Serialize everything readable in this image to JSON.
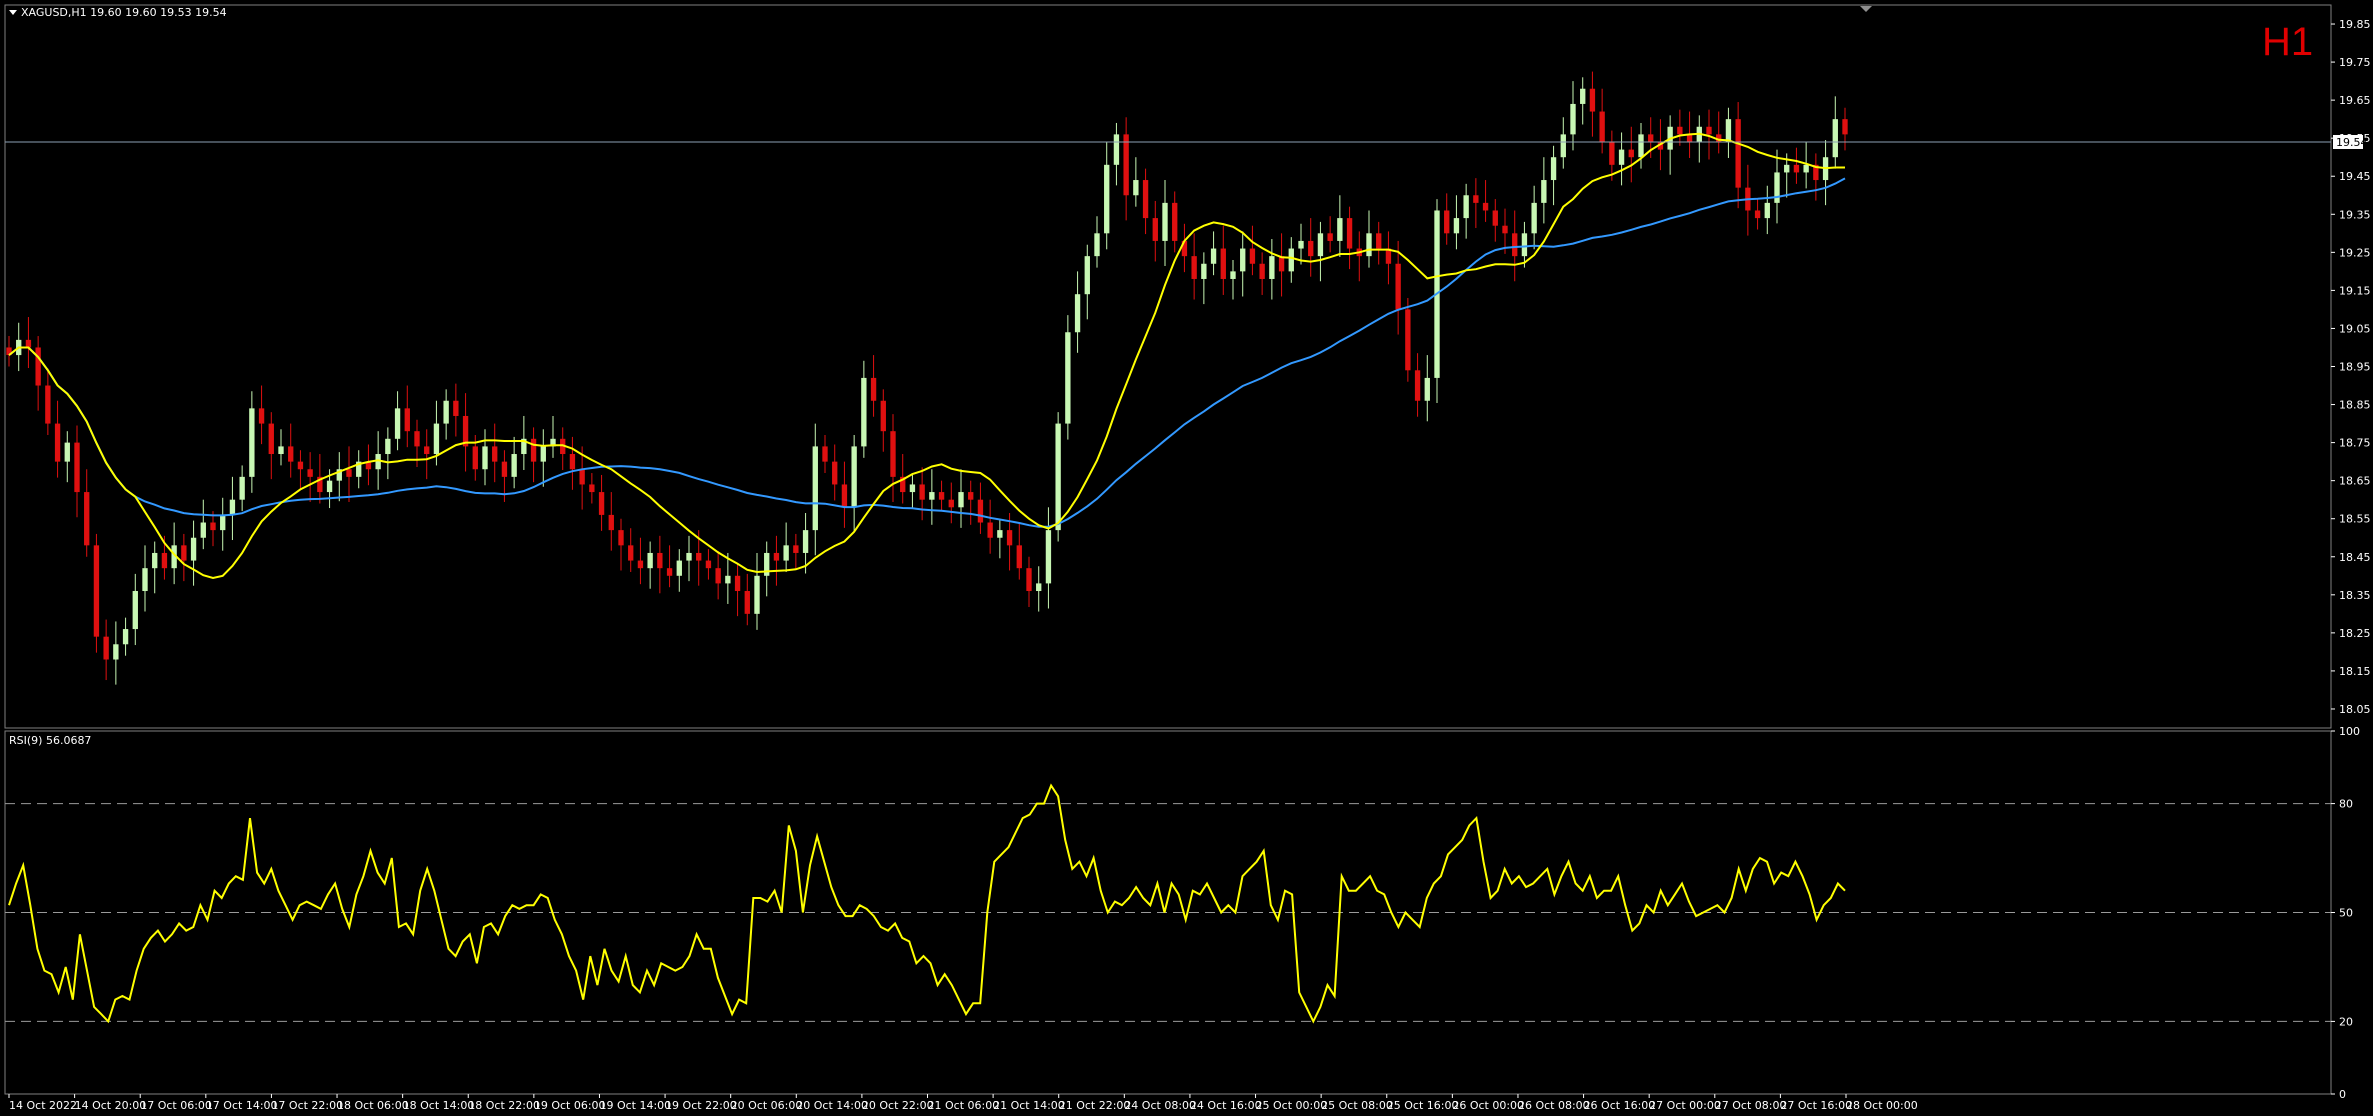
{
  "header": {
    "symbol_info": "XAGUSD,H1  19.60 19.60 19.53 19.54",
    "timeframe": "H1",
    "current_price": "19.54"
  },
  "rsi_panel": {
    "title": "RSI(9) 56.0687"
  },
  "colors": {
    "background": "#000000",
    "bull": "#c8f7b4",
    "bear": "#e01010",
    "ma_fast": "#ffff00",
    "ma_slow": "#3399ff",
    "rsi": "#ffff00",
    "timeframe_label": "#e00000"
  },
  "chart_data": [
    {
      "type": "candlestick",
      "ylim": [
        18.0,
        19.9
      ],
      "y_ticks": [
        "19.85",
        "19.75",
        "19.65",
        "19.55",
        "19.45",
        "19.35",
        "19.25",
        "19.15",
        "19.05",
        "18.95",
        "18.85",
        "18.75",
        "18.65",
        "18.55",
        "18.45",
        "18.35",
        "18.25",
        "18.15",
        "18.05"
      ],
      "x_ticks": [
        "14 Oct 2022",
        "14 Oct 20:00",
        "17 Oct 06:00",
        "17 Oct 14:00",
        "17 Oct 22:00",
        "18 Oct 06:00",
        "18 Oct 14:00",
        "18 Oct 22:00",
        "19 Oct 06:00",
        "19 Oct 14:00",
        "19 Oct 22:00",
        "20 Oct 06:00",
        "20 Oct 14:00",
        "20 Oct 22:00",
        "21 Oct 06:00",
        "21 Oct 14:00",
        "21 Oct 22:00",
        "24 Oct 08:00",
        "24 Oct 16:00",
        "25 Oct 00:00",
        "25 Oct 08:00",
        "25 Oct 16:00",
        "26 Oct 00:00",
        "26 Oct 08:00",
        "26 Oct 16:00",
        "27 Oct 00:00",
        "27 Oct 08:00",
        "27 Oct 16:00",
        "28 Oct 00:00"
      ],
      "close_series": [
        18.98,
        19.02,
        19.0,
        18.9,
        18.8,
        18.7,
        18.75,
        18.62,
        18.48,
        18.24,
        18.18,
        18.22,
        18.26,
        18.36,
        18.42,
        18.46,
        18.42,
        18.48,
        18.44,
        18.5,
        18.54,
        18.52,
        18.56,
        18.6,
        18.66,
        18.84,
        18.8,
        18.72,
        18.74,
        18.7,
        18.68,
        18.66,
        18.62,
        18.65,
        18.68,
        18.66,
        18.7,
        18.68,
        18.72,
        18.76,
        18.84,
        18.78,
        18.74,
        18.72,
        18.8,
        18.86,
        18.82,
        18.74,
        18.68,
        18.74,
        18.7,
        18.66,
        18.72,
        18.76,
        18.7,
        18.74,
        18.76,
        18.72,
        18.68,
        18.64,
        18.62,
        18.56,
        18.52,
        18.48,
        18.44,
        18.42,
        18.46,
        18.42,
        18.4,
        18.44,
        18.46,
        18.44,
        18.42,
        18.38,
        18.4,
        18.36,
        18.3,
        18.4,
        18.46,
        18.44,
        18.48,
        18.46,
        18.52,
        18.74,
        18.7,
        18.64,
        18.58,
        18.74,
        18.92,
        18.86,
        18.78,
        18.66,
        18.62,
        18.64,
        18.6,
        18.62,
        18.6,
        18.58,
        18.62,
        18.6,
        18.54,
        18.5,
        18.52,
        18.48,
        18.42,
        18.36,
        18.38,
        18.52,
        18.8,
        19.04,
        19.14,
        19.24,
        19.3,
        19.48,
        19.56,
        19.4,
        19.44,
        19.34,
        19.28,
        19.38,
        19.28,
        19.24,
        19.18,
        19.22,
        19.26,
        19.18,
        19.2,
        19.26,
        19.22,
        19.18,
        19.24,
        19.2,
        19.26,
        19.28,
        19.24,
        19.3,
        19.28,
        19.34,
        19.26,
        19.24,
        19.3,
        19.26,
        19.22,
        19.1,
        18.94,
        18.86,
        18.92,
        19.36,
        19.3,
        19.34,
        19.4,
        19.38,
        19.36,
        19.32,
        19.3,
        19.24,
        19.3,
        19.38,
        19.44,
        19.5,
        19.56,
        19.64,
        19.68,
        19.62,
        19.54,
        19.48,
        19.52,
        19.5,
        19.56,
        19.54,
        19.52,
        19.58,
        19.56,
        19.54,
        19.58,
        19.56,
        19.54,
        19.6,
        19.42,
        19.36,
        19.34,
        19.38,
        19.46,
        19.48,
        19.46,
        19.48,
        19.44,
        19.5,
        19.6,
        19.56
      ],
      "moving_averages": [
        {
          "values_start": 18.96,
          "values_end": 19.5
        },
        {
          "values_start": 19.05,
          "values_end": 19.42
        }
      ]
    },
    {
      "type": "line",
      "ylim": [
        0,
        100
      ],
      "y_ticks": [
        "100",
        "80",
        "50",
        "20",
        "0"
      ],
      "levels": [
        80,
        50,
        20
      ],
      "values": [
        52,
        58,
        63,
        52,
        40,
        34,
        33,
        28,
        35,
        26,
        44,
        34,
        24,
        22,
        20,
        26,
        27,
        26,
        34,
        40,
        43,
        45,
        42,
        44,
        47,
        45,
        46,
        52,
        48,
        56,
        54,
        58,
        60,
        59,
        76,
        61,
        58,
        62,
        56,
        52,
        48,
        52,
        53,
        52,
        51,
        55,
        58,
        51,
        46,
        55,
        60,
        67,
        61,
        58,
        65,
        46,
        47,
        44,
        56,
        62,
        56,
        48,
        40,
        38,
        42,
        44,
        36,
        46,
        47,
        44,
        49,
        52,
        51,
        52,
        52,
        55,
        54,
        48,
        44,
        38,
        34,
        26,
        38,
        30,
        40,
        34,
        31,
        38,
        30,
        28,
        34,
        30,
        36,
        35,
        34,
        35,
        38,
        44,
        40,
        40,
        32,
        27,
        22,
        26,
        25,
        54,
        54,
        53,
        56,
        50,
        74,
        67,
        50,
        63,
        71,
        64,
        57,
        52,
        49,
        49,
        52,
        51,
        49,
        46,
        45,
        47,
        43,
        42,
        36,
        38,
        36,
        30,
        33,
        30,
        26,
        22,
        25,
        25,
        50,
        64,
        66,
        68,
        72,
        76,
        77,
        80,
        80,
        85,
        82,
        70,
        62,
        64,
        60,
        65,
        56,
        50,
        53,
        52,
        54,
        57,
        54,
        52,
        58,
        50,
        58,
        55,
        48,
        56,
        55,
        58,
        54,
        50,
        52,
        50,
        60,
        62,
        64,
        67,
        52,
        48,
        56,
        55,
        28,
        24,
        20,
        24,
        30,
        27,
        60,
        56,
        56,
        58,
        60,
        56,
        55,
        50,
        46,
        50,
        48,
        46,
        54,
        58,
        60,
        66,
        68,
        70,
        74,
        76,
        64,
        54,
        56,
        62,
        58,
        60,
        57,
        58,
        60,
        62,
        55,
        60,
        64,
        58,
        56,
        60,
        54,
        56,
        56,
        60,
        52,
        45,
        47,
        52,
        50,
        56,
        52,
        55,
        58,
        53,
        49,
        50,
        51,
        52,
        50,
        54,
        62,
        56,
        62,
        65,
        64,
        58,
        61,
        60,
        64,
        60,
        55,
        48,
        52,
        54,
        58,
        56
      ],
      "title": "RSI(9) 56.0687"
    }
  ]
}
